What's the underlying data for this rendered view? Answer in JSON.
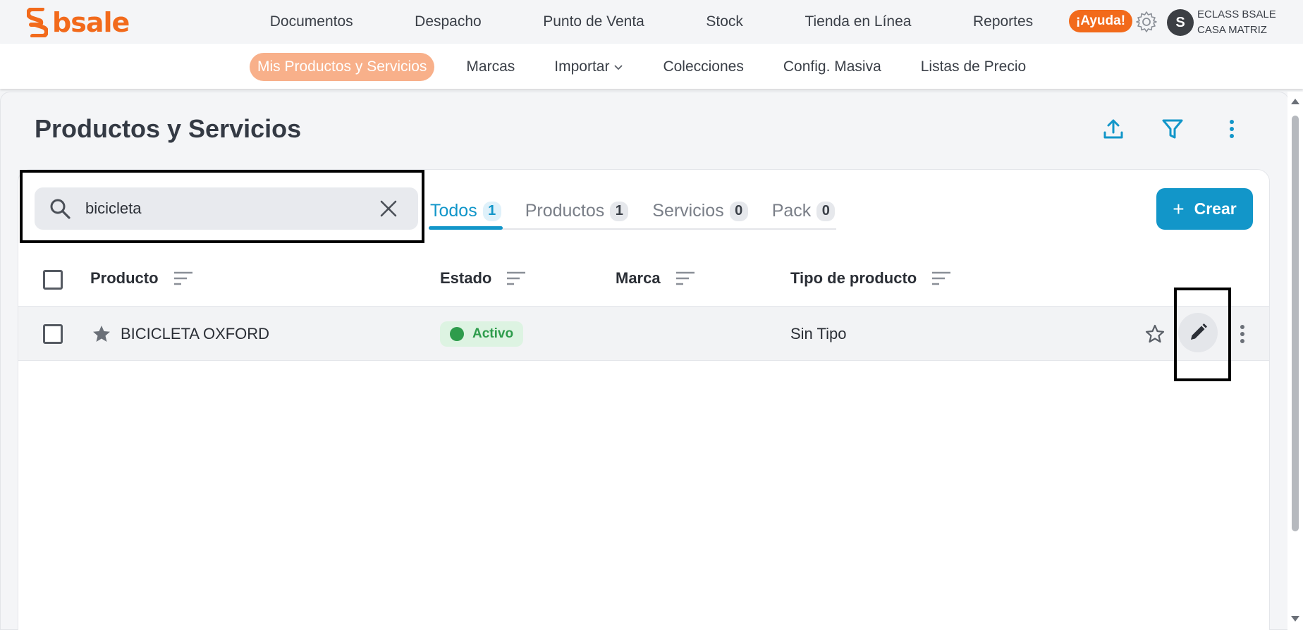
{
  "brand": {
    "name": "bsale",
    "color": "#f26a1b"
  },
  "main_nav": {
    "items": [
      "Documentos",
      "Despacho",
      "Punto de Venta",
      "Stock",
      "Tienda en Línea",
      "Reportes"
    ]
  },
  "header_right": {
    "help_label": "¡Ayuda!",
    "avatar_initial": "S",
    "company_line1": "ECLASS BSALE",
    "company_line2": "CASA MATRIZ"
  },
  "sub_nav": {
    "items": [
      {
        "label": "Mis Productos y Servicios",
        "active": true
      },
      {
        "label": "Marcas"
      },
      {
        "label": "Importar",
        "dropdown": true
      },
      {
        "label": "Colecciones"
      },
      {
        "label": "Config. Masiva"
      },
      {
        "label": "Listas de Precio"
      }
    ]
  },
  "page": {
    "title": "Productos y Servicios"
  },
  "search": {
    "value": "bicicleta"
  },
  "tabs": [
    {
      "label": "Todos",
      "count": "1",
      "active": true
    },
    {
      "label": "Productos",
      "count": "1"
    },
    {
      "label": "Servicios",
      "count": "0"
    },
    {
      "label": "Pack",
      "count": "0"
    }
  ],
  "create_button": {
    "plus": "+",
    "label": "Crear"
  },
  "table": {
    "columns": [
      "Producto",
      "Estado",
      "Marca",
      "Tipo de producto"
    ],
    "rows": [
      {
        "producto": "BICICLETA OXFORD",
        "estado": "Activo",
        "marca": "",
        "tipo": "Sin Tipo"
      }
    ]
  },
  "colors": {
    "accent": "#1296c9",
    "status_active": "#2e9c4c",
    "orange": "#f26a1b"
  }
}
